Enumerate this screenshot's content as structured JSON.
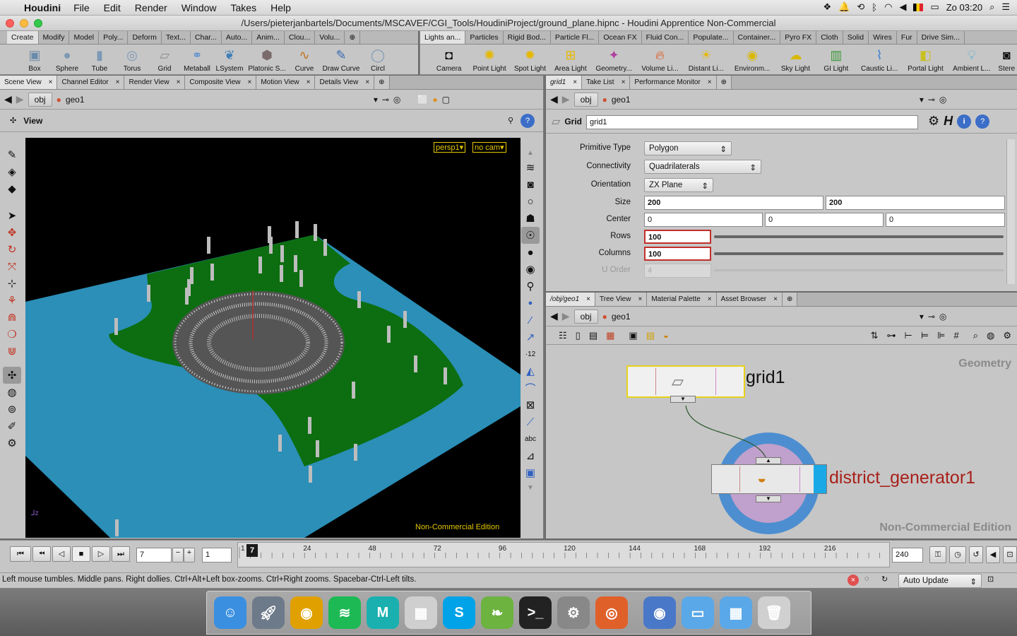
{
  "menubar": {
    "app": "Houdini",
    "items": [
      "File",
      "Edit",
      "Render",
      "Window",
      "Takes",
      "Help"
    ],
    "clock": "Zo 03:20"
  },
  "window": {
    "title": "/Users/pieterjanbartels/Documents/MSCAVEF/CGI_Tools/HoudiniProject/ground_plane.hipnc - Houdini Apprentice Non-Commercial"
  },
  "shelf_left": {
    "tabs": [
      "Create",
      "Modify",
      "Model",
      "Poly...",
      "Deform",
      "Text...",
      "Char...",
      "Auto...",
      "Anim...",
      "Clou...",
      "Volu..."
    ],
    "tools": [
      "Box",
      "Sphere",
      "Tube",
      "Torus",
      "Grid",
      "Metaball",
      "LSystem",
      "Platonic S...",
      "Curve",
      "Draw Curve",
      "Circl"
    ]
  },
  "shelf_right": {
    "tabs": [
      "Lights an...",
      "Particles",
      "Rigid Bod...",
      "Particle Fl...",
      "Ocean FX",
      "Fluid Con...",
      "Populate...",
      "Container...",
      "Pyro FX",
      "Cloth",
      "Solid",
      "Wires",
      "Fur",
      "Drive Sim..."
    ],
    "tools": [
      "Camera",
      "Point Light",
      "Spot Light",
      "Area Light",
      "Geometry...",
      "Volume Li...",
      "Distant Li...",
      "Environm...",
      "Sky Light",
      "GI Light",
      "Caustic Li...",
      "Portal Light",
      "Ambient L...",
      "Stere"
    ]
  },
  "viewer": {
    "tabs": [
      "Scene View",
      "Channel Editor",
      "Render View",
      "Composite View",
      "Motion View",
      "Details View"
    ],
    "path_root": "obj",
    "path_node": "geo1",
    "view_label": "View",
    "cam_persp": "persp1▾",
    "cam_none": "no cam▾",
    "watermark": "Non-Commercial Edition"
  },
  "params": {
    "tabs": [
      "grid1",
      "Take List",
      "Performance Monitor"
    ],
    "path_root": "obj",
    "path_node": "geo1",
    "node_type": "Grid",
    "node_name": "grid1",
    "rows": [
      {
        "label": "Primitive Type",
        "value": "Polygon"
      },
      {
        "label": "Connectivity",
        "value": "Quadrilaterals"
      },
      {
        "label": "Orientation",
        "value": "ZX Plane"
      },
      {
        "label": "Size",
        "v1": "200",
        "v2": "200"
      },
      {
        "label": "Center",
        "v1": "0",
        "v2": "0",
        "v3": "0"
      },
      {
        "label": "Rows",
        "value": "100"
      },
      {
        "label": "Columns",
        "value": "100"
      },
      {
        "label": "U Order",
        "value": "4"
      }
    ]
  },
  "network": {
    "tabs": [
      "/obj/geo1",
      "Tree View",
      "Material Palette",
      "Asset Browser"
    ],
    "path_root": "obj",
    "path_node": "geo1",
    "context_label": "Geometry",
    "watermark": "Non-Commercial Edition",
    "nodes": [
      {
        "name": "grid1"
      },
      {
        "name": "district_generator1"
      }
    ]
  },
  "timeline": {
    "current_frame": "7",
    "step": "1",
    "ticks": [
      "1",
      "24",
      "48",
      "72",
      "96",
      "120",
      "144",
      "168",
      "192",
      "216"
    ],
    "end_frame": "240",
    "start_label": "1"
  },
  "status": {
    "message": "Left mouse tumbles. Middle pans. Right dollies. Ctrl+Alt+Left box-zooms. Ctrl+Right zooms. Spacebar-Ctrl-Left tilts.",
    "update_mode": "Auto Update"
  },
  "dock": {
    "apps": [
      "Finder",
      "Launchpad",
      "Chrome",
      "Spotify",
      "Maya",
      "Preview",
      "Skype",
      "Evernote",
      "Terminal",
      "System Preferences",
      "Houdini",
      "Chrome Canary",
      "Folder",
      "Applications",
      "Trash"
    ]
  },
  "colors": {
    "grass": "#0c6e10",
    "water": "#2b8fb8",
    "selected_node": "#f5e23c",
    "district_label": "#a8201a",
    "display_flag": "#1aa8e6"
  }
}
